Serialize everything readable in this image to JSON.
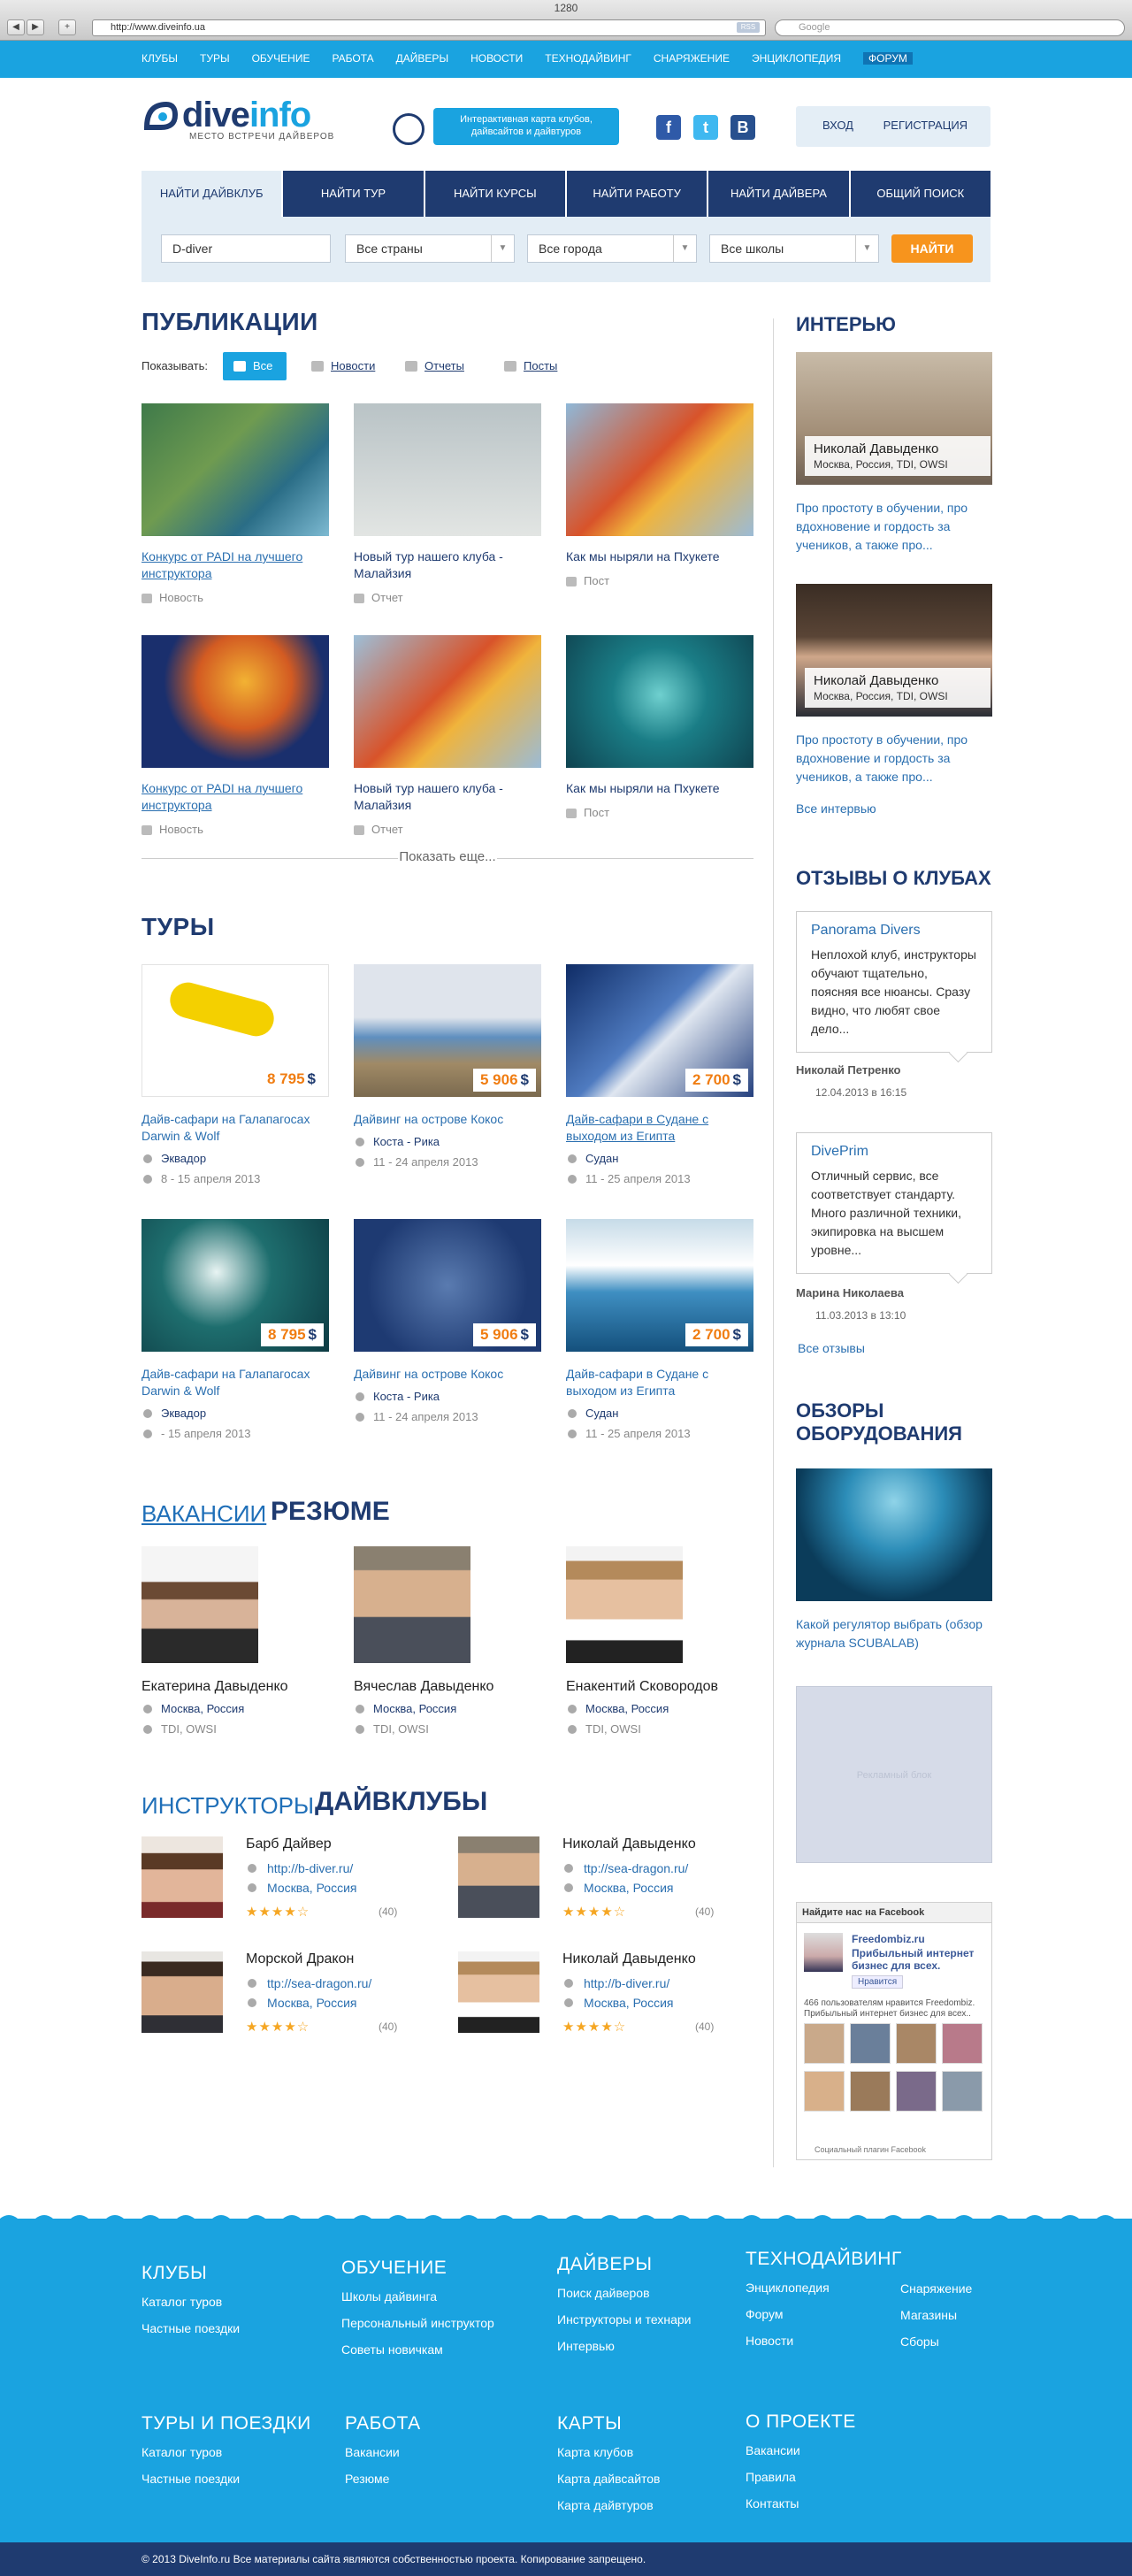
{
  "chrome": {
    "title": "1280",
    "url": "http://www.diveinfo.ua",
    "rss": "RSS",
    "search_placeholder": "Google"
  },
  "topnav": [
    "КЛУБЫ",
    "ТУРЫ",
    "ОБУЧЕНИЕ",
    "РАБОТА",
    "ДАЙВЕРЫ",
    "НОВОСТИ",
    "ТЕХНОДАЙВИНГ",
    "СНАРЯЖЕНИЕ",
    "ЭНЦИКЛОПЕДИЯ",
    "ФОРУМ"
  ],
  "header": {
    "logo_a": "dive",
    "logo_b": "info",
    "slogan": "МЕСТО ВСТРЕЧИ ДАЙВЕРОВ",
    "map_text": "Интерактивная карта клубов, дайвсайтов и дайвтуров",
    "social": {
      "fb": "f",
      "tw": "t",
      "vk": "B"
    },
    "login": "ВХОД",
    "register": "РЕГИСТРАЦИЯ"
  },
  "search": {
    "tabs": [
      "НАЙТИ ДАЙВКЛУБ",
      "НАЙТИ ТУР",
      "НАЙТИ КУРСЫ",
      "НАЙТИ РАБОТУ",
      "НАЙТИ ДАЙВЕРА",
      "ОБЩИЙ ПОИСК"
    ],
    "query": "D-diver",
    "country": "Все страны",
    "city": "Все города",
    "school": "Все школы",
    "button": "НАЙТИ"
  },
  "publications": {
    "title": "ПУБЛИКАЦИИ",
    "show_label": "Показывать:",
    "filters": [
      "Все",
      "Новости",
      "Отчеты",
      "Посты"
    ],
    "items": [
      {
        "title": "Конкурс от PADI на лучшего инструктора",
        "type": "Новость"
      },
      {
        "title": "Новый тур нашего клуба - Малайзия",
        "type": "Отчет"
      },
      {
        "title": "Как мы ныряли на Пхукете",
        "type": "Пост"
      },
      {
        "title": "Конкурс от PADI на лучшего инструктора",
        "type": "Новость"
      },
      {
        "title": "Новый тур нашего клуба - Малайзия",
        "type": "Отчет"
      },
      {
        "title": "Как мы ныряли на Пхукете",
        "type": "Пост"
      }
    ],
    "more": "Показать еще..."
  },
  "tours": {
    "title": "ТУРЫ",
    "currency": "$",
    "items": [
      {
        "price": "8 795",
        "title": "Дайв-сафари на Галапагосах Darwin & Wolf",
        "country": "Эквадор",
        "dates": "8 - 15 апреля 2013"
      },
      {
        "price": "5 906",
        "title": "Дайвинг на острове Кокос",
        "country": "Коста - Рика",
        "dates": "11 - 24 апреля 2013"
      },
      {
        "price": "2 700",
        "title": "Дайв-сафари в Судане с выходом из Египта",
        "country": "Судан",
        "dates": "11 - 25 апреля 2013"
      },
      {
        "price": "8 795",
        "title": "Дайв-сафари на Галапагосах Darwin & Wolf",
        "country": "Эквадор",
        "dates": "- 15 апреля 2013"
      },
      {
        "price": "5 906",
        "title": "Дайвинг на острове Кокос",
        "country": "Коста - Рика",
        "dates": "11 - 24 апреля 2013"
      },
      {
        "price": "2 700",
        "title": "Дайв-сафари в Судане с выходом из Египта",
        "country": "Судан",
        "dates": "11 - 25 апреля 2013"
      }
    ]
  },
  "jobs": {
    "tab_a": "ВАКАНСИИ",
    "tab_b": "РЕЗЮМЕ",
    "people": [
      {
        "name": "Екатерина Давыденко",
        "loc": "Москва, Россия",
        "certs": "TDI, OWSI"
      },
      {
        "name": "Вячеслав Давыденко",
        "loc": "Москва, Россия",
        "certs": "TDI, OWSI"
      },
      {
        "name": "Енакентий Сковородов",
        "loc": "Москва, Россия",
        "certs": "TDI, OWSI"
      }
    ]
  },
  "instructors": {
    "tab_a": "ИНСТРУКТОРЫ",
    "tab_b": "ДАЙВКЛУБЫ",
    "items": [
      {
        "name": "Барб Дайвер",
        "url": "http://b-diver.ru/",
        "loc": "Москва, Россия",
        "stars": "★★★★☆",
        "comments": "(40)"
      },
      {
        "name": "Николай Давыденко",
        "url": "ttp://sea-dragon.ru/",
        "loc": "Москва, Россия",
        "stars": "★★★★☆",
        "comments": "(40)"
      },
      {
        "name": "Морской Дракон",
        "url": "ttp://sea-dragon.ru/",
        "loc": "Москва, Россия",
        "stars": "★★★★☆",
        "comments": "(40)"
      },
      {
        "name": "Николай Давыденко",
        "url": "http://b-diver.ru/",
        "loc": "Москва, Россия",
        "stars": "★★★★☆",
        "comments": "(40)"
      }
    ]
  },
  "sidebar": {
    "interview_title": "ИНТЕРЬЮ",
    "interviews": [
      {
        "name": "Николай Давыденко",
        "sub": "Москва, Россия, TDI, OWSI",
        "text": "Про простоту в обучении, про вдохновение и гордость за учеников, а также про..."
      },
      {
        "name": "Николай Давыденко",
        "sub": "Москва, Россия, TDI, OWSI",
        "text": "Про простоту в обучении, про вдохновение и гордость за учеников, а также про..."
      }
    ],
    "all_interviews": "Все интервью",
    "reviews_title": "ОТЗЫВЫ О КЛУБАХ",
    "reviews": [
      {
        "club": "Panorama Divers",
        "text": "Неплохой клуб, инструкторы обучают тщательно, поясняя все нюансы. Сразу видно, что любят свое дело...",
        "author": "Николай Петренко",
        "date": "12.04.2013  в 16:15"
      },
      {
        "club": "DivePrim",
        "text": "Отличный сервис, все соответствует стандарту. Много различной техники, экипировка на высшем уровне...",
        "author": "Марина Николаева",
        "date": "11.03.2013  в 13:10"
      }
    ],
    "all_reviews": "Все отзывы",
    "gear_title": "ОБЗОРЫ ОБОРУДОВАНИЯ",
    "gear_text": "Какой регулятор выбрать (обзор журнала SCUBALAB)",
    "banner": "Рекламный блок",
    "fb": {
      "head": "Найдите нас на Facebook",
      "page": "Freedombiz.ru",
      "desc": "Прибыльный интернет бизнес для всех.",
      "like": "Нравится",
      "count": "466 пользователям нравится Freedombiz. Прибыльный интернет бизнес для всех..",
      "plugin": "Социальный плагин Facebook"
    }
  },
  "footer": {
    "cols": [
      {
        "title": "КЛУБЫ",
        "links": [
          "Каталог туров",
          "Частные поездки"
        ]
      },
      {
        "title": "ОБУЧЕНИЕ",
        "links": [
          "Школы дайвинга",
          "Персональный инструктор",
          "Советы новичкам"
        ]
      },
      {
        "title": "ДАЙВЕРЫ",
        "links": [
          "Поиск дайверов",
          "Инструкторы и технари",
          "Интервью"
        ]
      },
      {
        "title": "ТЕХНОДАЙВИНГ",
        "links": [
          "Энциклопедия",
          "Форум",
          "Новости"
        ]
      },
      {
        "title": "",
        "links": [
          "Снаряжение",
          "Магазины",
          "Сборы"
        ]
      },
      {
        "title": "ТУРЫ И ПОЕЗДКИ",
        "links": [
          "Каталог туров",
          "Частные поездки"
        ]
      },
      {
        "title": "РАБОТА",
        "links": [
          "Вакансии",
          "Резюме"
        ]
      },
      {
        "title": "КАРТЫ",
        "links": [
          "Карта клубов",
          "Карта дайвсайтов",
          "Карта дайвтуров"
        ]
      },
      {
        "title": "О ПРОЕКТЕ",
        "links": [
          "Вакансии",
          "Правила",
          "Контакты"
        ]
      }
    ],
    "copyright": "© 2013 DiveInfo.ru Все материалы сайта являются собственностью проекта. Копирование запрещено."
  },
  "colors": {
    "accent": "#1aa3e0",
    "navy": "#1f3b70",
    "orange": "#f7941d"
  }
}
